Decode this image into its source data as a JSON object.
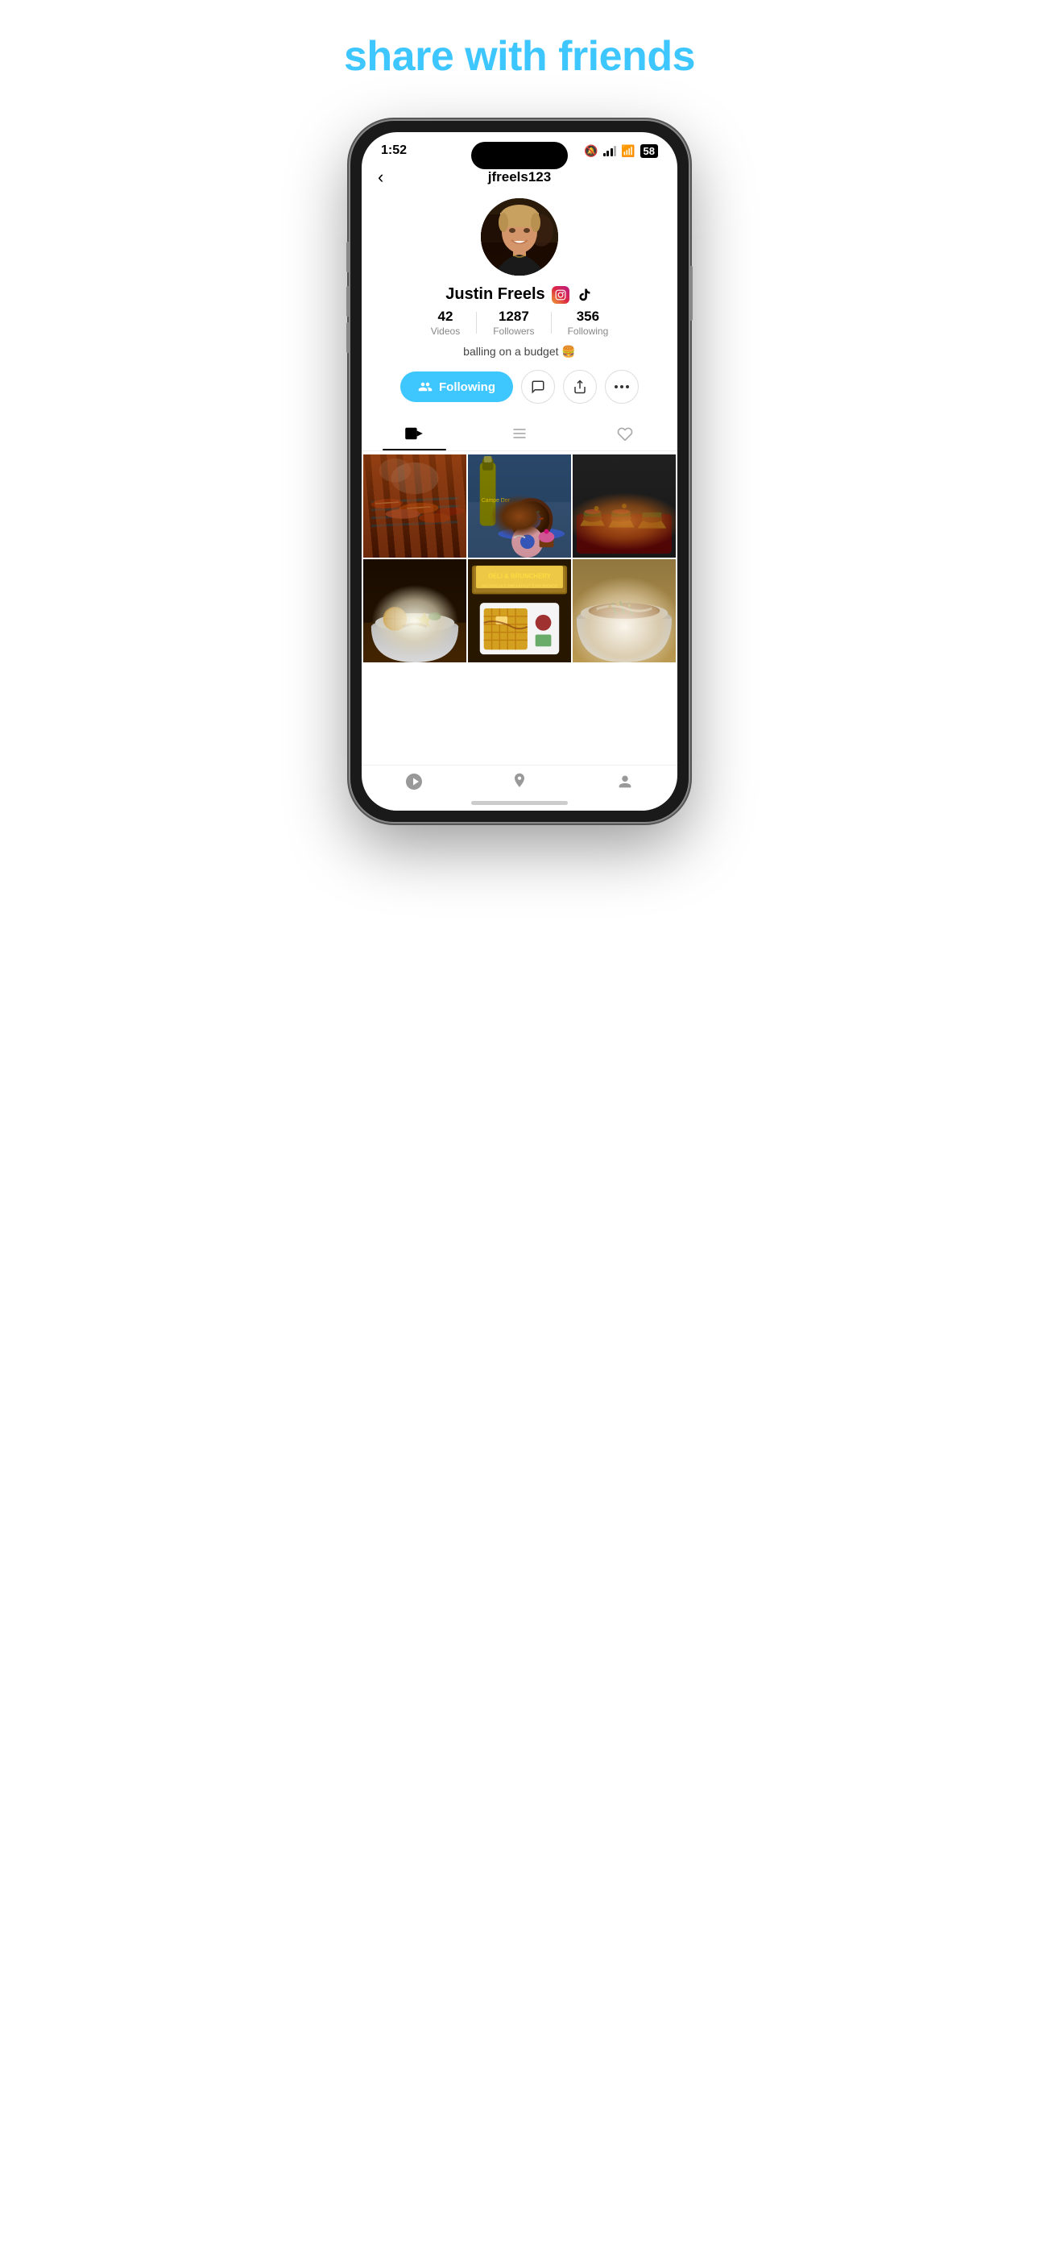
{
  "page": {
    "headline": "share with friends",
    "headline_color": "#3EC6FF"
  },
  "status_bar": {
    "time": "1:52",
    "mute_icon": "🔕",
    "battery": "58"
  },
  "nav": {
    "back_label": "‹",
    "title": "jfreels123"
  },
  "profile": {
    "username": "jfreels123",
    "display_name": "Justin Freels",
    "bio": "balling on a budget 🍔",
    "stats": {
      "videos": {
        "count": "42",
        "label": "Videos"
      },
      "followers": {
        "count": "1287",
        "label": "Followers"
      },
      "following": {
        "count": "356",
        "label": "Following"
      }
    }
  },
  "action_buttons": {
    "following_label": "Following",
    "message_icon": "💬",
    "share_icon": "↑",
    "more_icon": "⋯"
  },
  "tabs": [
    {
      "id": "videos",
      "icon": "🎬",
      "active": true
    },
    {
      "id": "list",
      "icon": "☰",
      "active": false
    },
    {
      "id": "liked",
      "icon": "♡",
      "active": false
    }
  ],
  "grid": {
    "items": [
      {
        "id": 1,
        "class": "food-1",
        "alt": "Grilled ribs on a grill"
      },
      {
        "id": 2,
        "class": "food-2",
        "alt": "Donuts and champagne"
      },
      {
        "id": 3,
        "class": "food-3",
        "alt": "Tacos on dark background"
      },
      {
        "id": 4,
        "class": "food-4",
        "alt": "Bowl with food"
      },
      {
        "id": 5,
        "class": "food-5",
        "alt": "Deli and Brunchery sign with waffles"
      },
      {
        "id": 6,
        "class": "food-6",
        "alt": "Loaded bowl dish"
      }
    ]
  },
  "bottom_nav": [
    {
      "id": "explore",
      "icon": "🔥"
    },
    {
      "id": "location",
      "icon": "📍"
    },
    {
      "id": "profile",
      "icon": "👤"
    }
  ]
}
